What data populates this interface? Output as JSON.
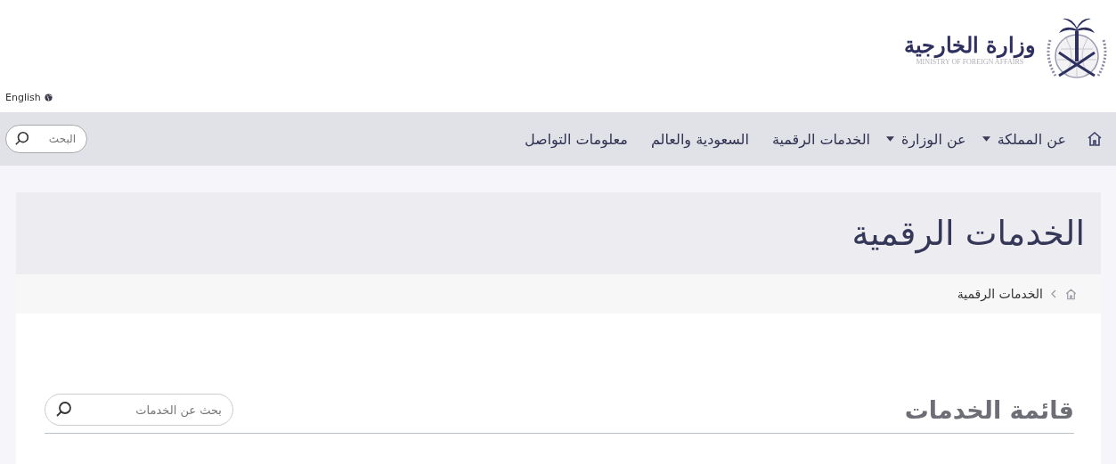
{
  "logo": {
    "arabic": "وزارة الخارجية",
    "english": "MINISTRY OF FOREIGN AFFAIRS"
  },
  "language_link": "English",
  "nav": {
    "items": [
      {
        "label": "عن المملكة",
        "dropdown": true
      },
      {
        "label": "عن الوزارة",
        "dropdown": true
      },
      {
        "label": "الخدمات الرقمية",
        "dropdown": false
      },
      {
        "label": "السعودية والعالم",
        "dropdown": false
      },
      {
        "label": "معلومات التواصل",
        "dropdown": false
      }
    ],
    "search": {
      "placeholder": "البحث"
    }
  },
  "page_title": "الخدمات الرقمية",
  "breadcrumb": [
    "الخدمات الرقمية"
  ],
  "section": {
    "title": "قائمة الخدمات",
    "search": {
      "placeholder": "بحث عن الخدمات"
    }
  }
}
